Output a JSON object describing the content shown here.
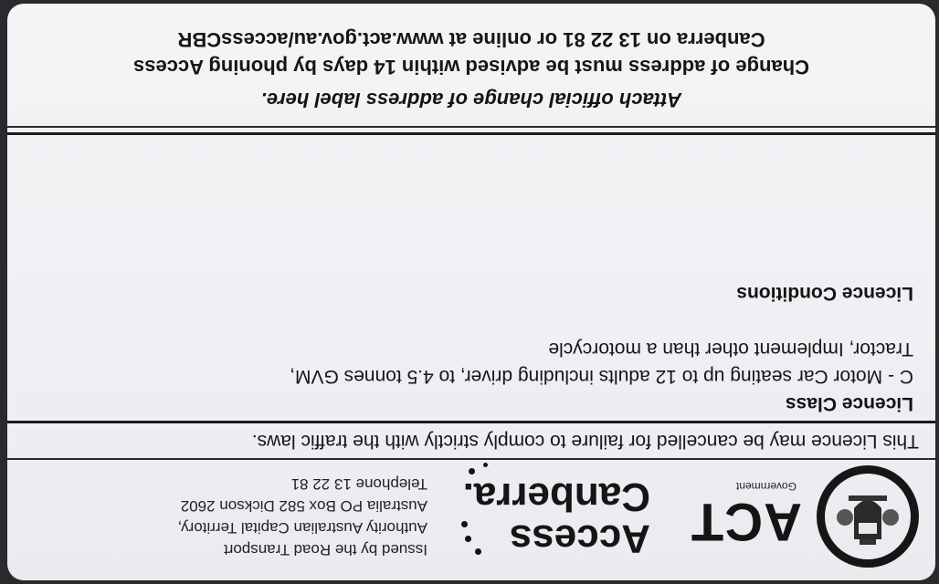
{
  "issuer": {
    "lines": [
      "Issued by the Road Transport",
      "Authority  Australian Capital Territory,",
      "Australia  PO Box 582  Dickson 2602",
      "Telephone 13 22 81"
    ],
    "act_logo_text": "ACT",
    "act_logo_subtext": "Government",
    "access_canberra_logo": [
      "Access",
      "Canberra."
    ]
  },
  "notice": "This Licence may be cancelled for failure to comply strictly with the traffic laws.",
  "licence_class": {
    "heading": "Licence Class",
    "lines": [
      "C - Motor Car seating up to 12 adults including driver, to 4.5 tonnes GVM,",
      "Tractor, Implement other than a motorcycle"
    ]
  },
  "licence_conditions": {
    "heading": "Licence Conditions"
  },
  "address_change": {
    "title": "Attach official change of address label here.",
    "lines": [
      "Change of address must be advised within 14 days by phoning Access",
      "Canberra on 13 22 81 or online at www.act.gov.au/accessCBR"
    ]
  },
  "colors": {
    "card": "#f1f2f5",
    "ink": "#161616",
    "background": "#2a2a2e"
  }
}
